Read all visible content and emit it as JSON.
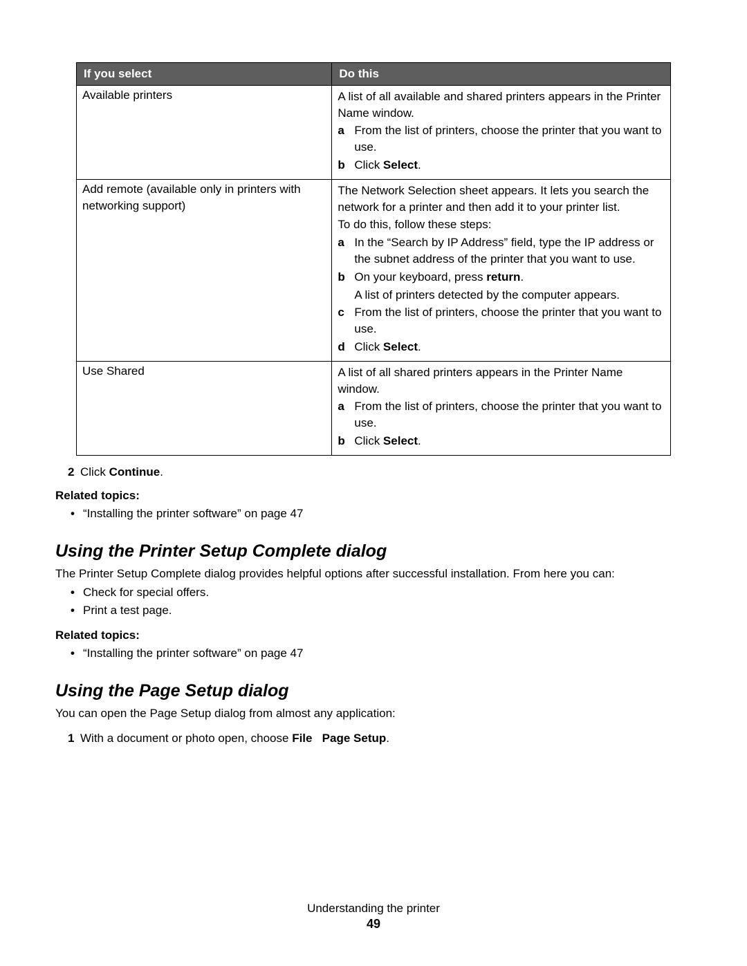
{
  "table": {
    "headers": {
      "left": "If you select",
      "right": "Do this"
    },
    "rows": [
      {
        "left": "Available printers",
        "intro": "A list of all available and shared printers appears in the Printer Name window.",
        "steps": [
          {
            "m": "a",
            "text": "From the list of printers, choose the printer that you want to use."
          },
          {
            "m": "b",
            "prefix": "Click ",
            "bold": "Select",
            "suffix": "."
          }
        ]
      },
      {
        "left": "Add remote (available only in printers with networking support)",
        "intro": "The Network Selection sheet appears. It lets you search the network for a printer and then add it to your printer list.",
        "sub_intro": "To do this, follow these steps:",
        "steps": [
          {
            "m": "a",
            "text": "In the “Search by IP Address” field, type the IP address or the subnet address of the printer that you want to use."
          },
          {
            "m": "b",
            "prefix": "On your keyboard, press ",
            "bold": "return",
            "suffix": ".",
            "after": "A list of printers detected by the computer appears."
          },
          {
            "m": "c",
            "text": "From the list of printers, choose the printer that you want to use."
          },
          {
            "m": "d",
            "prefix": "Click ",
            "bold": "Select",
            "suffix": "."
          }
        ]
      },
      {
        "left": "Use Shared",
        "intro": "A list of all shared printers appears in the Printer Name window.",
        "steps": [
          {
            "m": "a",
            "text": "From the list of printers, choose the printer that you want to use."
          },
          {
            "m": "b",
            "prefix": "Click ",
            "bold": "Select",
            "suffix": "."
          }
        ]
      }
    ]
  },
  "step2": {
    "num": "2",
    "prefix": "Click ",
    "bold": "Continue",
    "suffix": "."
  },
  "related1": {
    "heading": "Related topics:",
    "items": [
      "“Installing the printer software” on page 47"
    ]
  },
  "section1": {
    "title": "Using the Printer Setup Complete dialog",
    "body": "The Printer Setup Complete dialog provides helpful options after successful installation. From here you can:",
    "bullets": [
      "Check for special offers.",
      "Print a test page."
    ]
  },
  "related2": {
    "heading": "Related topics:",
    "items": [
      "“Installing the printer software” on page 47"
    ]
  },
  "section2": {
    "title": "Using the Page Setup dialog",
    "body": "You can open the Page Setup dialog from almost any application:",
    "step": {
      "num": "1",
      "prefix": "With a document or photo open, choose ",
      "bold1": "File",
      "mid": "   ",
      "bold2": "Page Setup",
      "suffix": "."
    }
  },
  "footer": {
    "chapter": "Understanding the printer",
    "page": "49"
  }
}
